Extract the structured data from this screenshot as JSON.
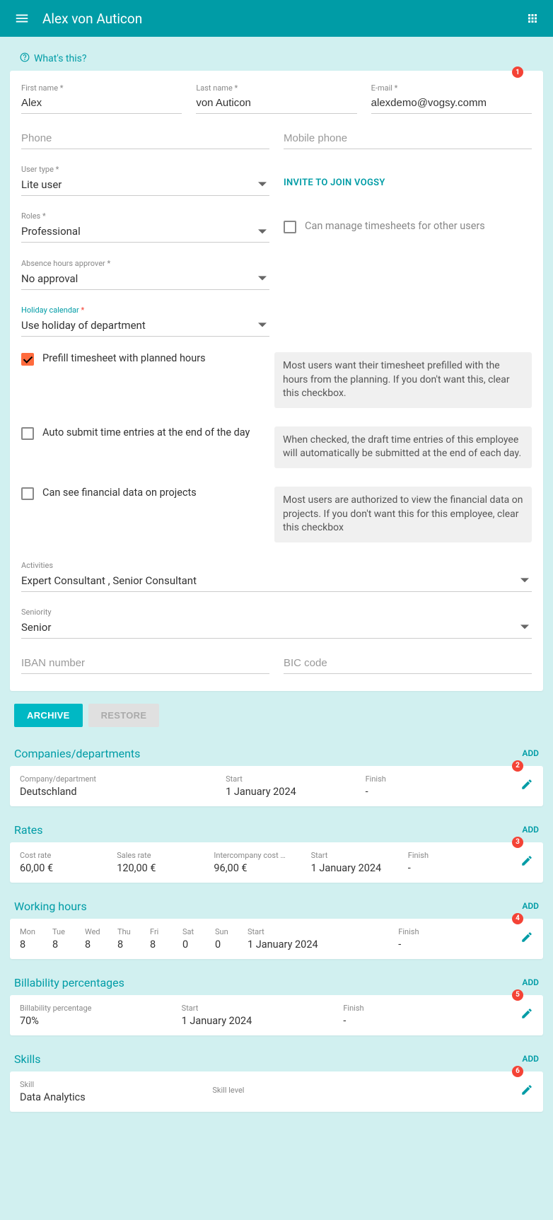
{
  "header": {
    "title": "Alex von Auticon"
  },
  "whats_this": "What's this?",
  "callouts": [
    "1",
    "2",
    "3",
    "4",
    "5",
    "6"
  ],
  "form": {
    "first_name": {
      "label": "First name",
      "value": "Alex"
    },
    "last_name": {
      "label": "Last name",
      "value": "von Auticon"
    },
    "email": {
      "label": "E-mail",
      "value": "alexdemo@vogsy.comm"
    },
    "phone": {
      "placeholder": "Phone"
    },
    "mobile": {
      "placeholder": "Mobile phone"
    },
    "user_type": {
      "label": "User type",
      "value": "Lite user"
    },
    "invite_btn": "INVITE TO JOIN VOGSY",
    "roles": {
      "label": "Roles",
      "value": "Professional"
    },
    "manage_timesheets": {
      "label": "Can manage timesheets for other users"
    },
    "absence_approver": {
      "label": "Absence hours approver",
      "value": "No approval"
    },
    "holiday_calendar": {
      "label": "Holiday calendar",
      "value": "Use holiday of department"
    },
    "prefill": {
      "label": "Prefill timesheet with planned hours",
      "help": "Most users want their timesheet prefilled with the hours from the planning. If you don't want this, clear this checkbox."
    },
    "autosubmit": {
      "label": "Auto submit time entries at the end of the day",
      "help": "When checked, the draft time entries of this employee will automatically be submitted at the end of each day."
    },
    "financial": {
      "label": "Can see financial data on projects",
      "help": "Most users are authorized to view the financial data on projects. If you don't want this for this employee, clear this checkbox"
    },
    "activities": {
      "label": "Activities",
      "value": "Expert Consultant , Senior Consultant"
    },
    "seniority": {
      "label": "Seniority",
      "value": "Senior"
    },
    "iban": {
      "placeholder": "IBAN number"
    },
    "bic": {
      "placeholder": "BIC code"
    }
  },
  "buttons": {
    "archive": "ARCHIVE",
    "restore": "RESTORE"
  },
  "add_label": "ADD",
  "sections": {
    "companies": {
      "title": "Companies/departments",
      "headers": {
        "company": "Company/department",
        "start": "Start",
        "finish": "Finish"
      },
      "row": {
        "company": "Deutschland",
        "start": "1 January 2024",
        "finish": "-"
      }
    },
    "rates": {
      "title": "Rates",
      "headers": {
        "cost": "Cost rate",
        "sales": "Sales rate",
        "inter": "Intercompany cost …",
        "start": "Start",
        "finish": "Finish"
      },
      "row": {
        "cost": "60,00 €",
        "sales": "120,00 €",
        "inter": "96,00 €",
        "start": "1 January 2024",
        "finish": "-"
      }
    },
    "hours": {
      "title": "Working hours",
      "headers": [
        "Mon",
        "Tue",
        "Wed",
        "Thu",
        "Fri",
        "Sat",
        "Sun",
        "Start",
        "Finish"
      ],
      "row": {
        "days": [
          "8",
          "8",
          "8",
          "8",
          "8",
          "0",
          "0"
        ],
        "start": "1 January 2024",
        "finish": "-"
      }
    },
    "billability": {
      "title": "Billability percentages",
      "headers": {
        "pct": "Billability percentage",
        "start": "Start",
        "finish": "Finish"
      },
      "row": {
        "pct": "70%",
        "start": "1 January 2024",
        "finish": "-"
      }
    },
    "skills": {
      "title": "Skills",
      "headers": {
        "skill": "Skill",
        "level": "Skill level"
      },
      "row": {
        "skill": "Data Analytics",
        "level": ""
      }
    }
  }
}
